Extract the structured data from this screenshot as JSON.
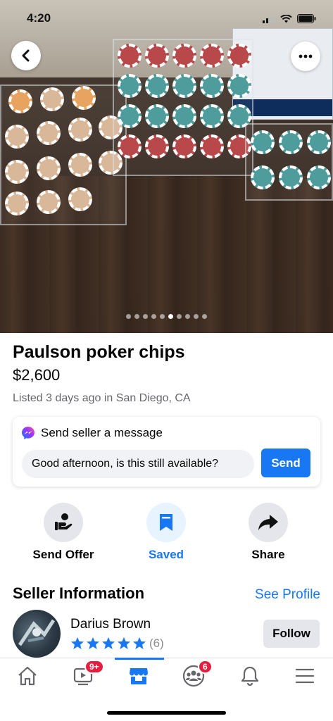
{
  "status_bar": {
    "time": "4:20"
  },
  "photo": {
    "page_count": 10,
    "active_index": 5
  },
  "listing": {
    "title": "Paulson poker chips",
    "price": "$2,600",
    "meta": "Listed 3 days ago in San Diego, CA"
  },
  "message": {
    "heading": "Send seller a message",
    "input_value": "Good afternoon, is this still available?",
    "send_label": "Send"
  },
  "actions": [
    {
      "label": "Send Offer",
      "icon": "offer-icon"
    },
    {
      "label": "Saved",
      "icon": "bookmark-icon",
      "active": true
    },
    {
      "label": "Share",
      "icon": "share-icon"
    }
  ],
  "seller": {
    "heading": "Seller Information",
    "see_profile": "See Profile",
    "name": "Darius Brown",
    "rating": 5,
    "rating_count": "(6)",
    "follow_label": "Follow"
  },
  "tabbar": {
    "items": [
      {
        "icon": "home-icon"
      },
      {
        "icon": "video-icon",
        "badge": "9+"
      },
      {
        "icon": "marketplace-icon",
        "active": true
      },
      {
        "icon": "groups-icon",
        "badge": "6"
      },
      {
        "icon": "bell-icon"
      },
      {
        "icon": "menu-icon"
      }
    ]
  },
  "colors": {
    "accent": "#1877f2",
    "badge": "#e41e3f",
    "muted": "#65676b"
  }
}
